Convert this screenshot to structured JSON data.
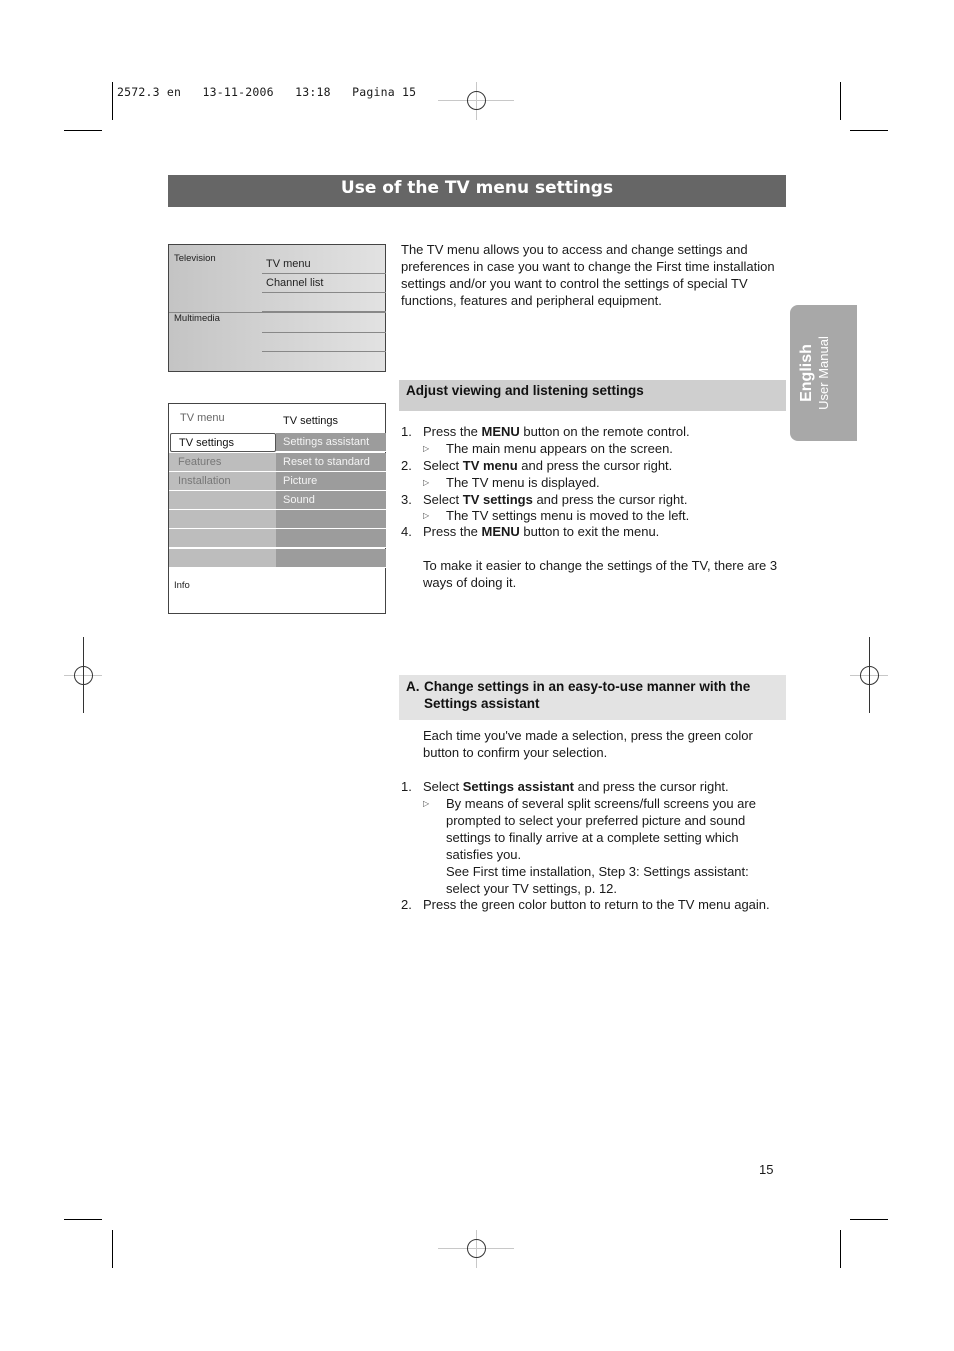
{
  "slug": "2572.3 en   13-11-2006   13:18   Pagina 15",
  "title": "Use of the TV menu settings",
  "screen_main_menu": {
    "left_labels": [
      "Television",
      "Multimedia"
    ],
    "items": [
      "TV menu",
      "Channel list",
      "",
      "",
      "",
      ""
    ]
  },
  "screen_tv_menu": {
    "left_header": "TV menu",
    "right_header": "TV settings",
    "left_items": [
      "TV settings",
      "Features",
      "Installation",
      "",
      "",
      "",
      ""
    ],
    "right_items": [
      "Settings assistant",
      "Reset to standard",
      "Picture",
      "Sound",
      "",
      "",
      ""
    ],
    "selected_item": "TV settings",
    "info_label": "Info"
  },
  "intro": "The TV menu allows you to access and change settings and preferences in case you want to change the First time installation settings and/or you want to control the settings of special TV functions, features and peripheral equipment.",
  "section1": {
    "heading": "Adjust viewing and listening settings",
    "steps": [
      {
        "num": "1.",
        "pre": "Press the ",
        "bold": "MENU",
        "post": " button on the remote control.",
        "result": "The main menu appears on the screen."
      },
      {
        "num": "2.",
        "pre": "Select ",
        "bold": "TV menu",
        "post": " and press the cursor right.",
        "result": "The TV menu is displayed."
      },
      {
        "num": "3.",
        "pre": "Select ",
        "bold": "TV settings",
        "post": " and press the cursor right.",
        "result": "The TV settings menu is moved to the left."
      },
      {
        "num": "4.",
        "pre": "Press the ",
        "bold": "MENU",
        "post": " button to exit the menu.",
        "result": ""
      }
    ],
    "note": "To make it easier to change the settings of the TV, there are 3 ways of doing it."
  },
  "section2": {
    "letter": "A.",
    "heading": "Change settings in an easy-to-use manner with the Settings assistant",
    "intro": "Each time you've made a selection, press the green color button to confirm your selection.",
    "steps": [
      {
        "num": "1.",
        "pre": "Select ",
        "bold": "Settings assistant",
        "post": " and press the cursor right.",
        "result": "By means of several split screens/full screens you are prompted to select your preferred picture and sound settings to finally arrive at a complete setting which satisfies you.",
        "result2": "See First time installation, Step 3: Settings assistant: select your TV settings, p. 12."
      },
      {
        "num": "2.",
        "text": "Press the green color button to return to the TV menu again."
      }
    ]
  },
  "side_tab": {
    "language": "English",
    "subtitle": "User Manual"
  },
  "result_icon": "triangle-right-outline-icon",
  "page_number": "15"
}
